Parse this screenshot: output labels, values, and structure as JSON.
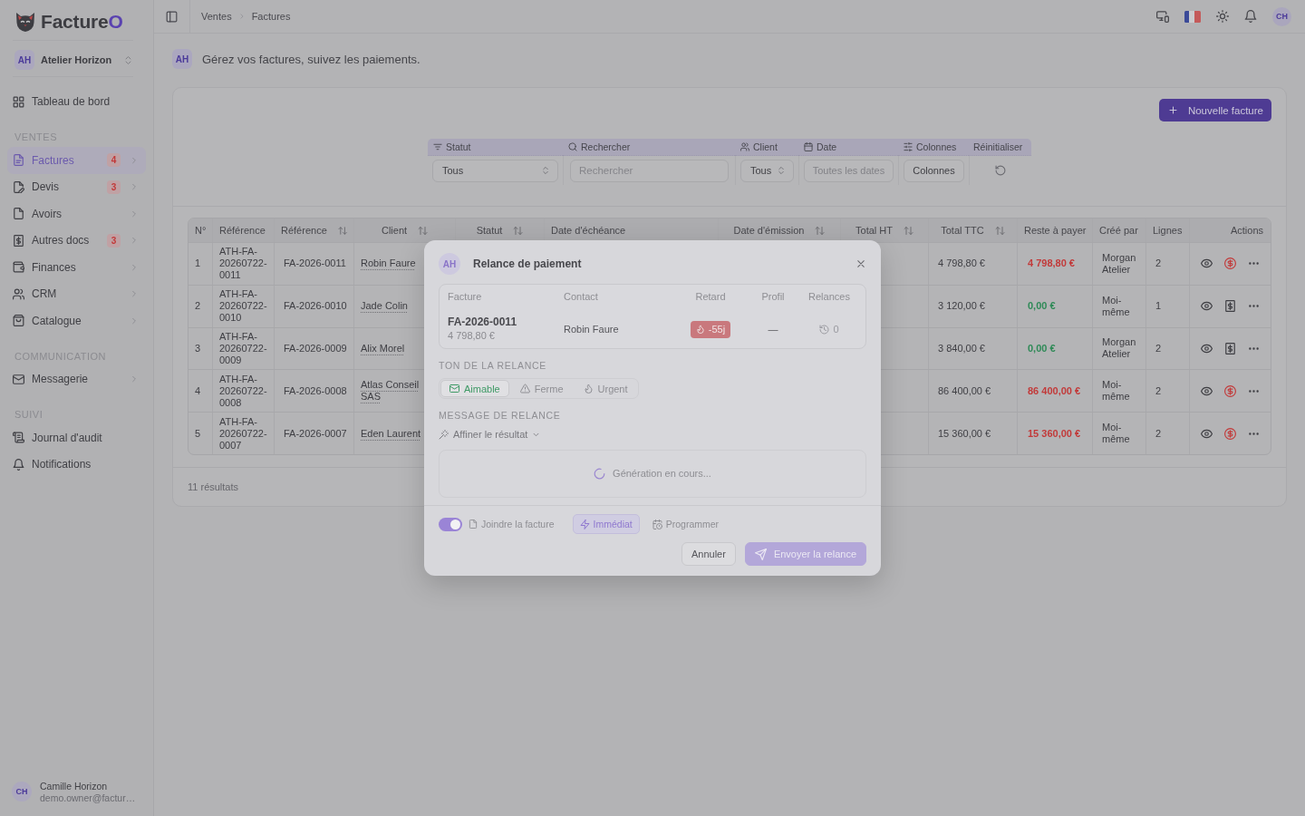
{
  "sidebar": {
    "brand": {
      "name": "Facture",
      "accent": "O"
    },
    "workspace": {
      "initials": "AH",
      "name": "Atelier Horizon"
    },
    "sections": [
      {
        "items": [
          {
            "kind": "dashboard",
            "label": "Tableau de bord",
            "selected": false,
            "expandable": false
          }
        ]
      },
      {
        "title": "VENTES",
        "items": [
          {
            "kind": "invoices",
            "label": "Factures",
            "selected": true,
            "badge": "4",
            "expandable": true
          },
          {
            "kind": "quotes",
            "label": "Devis",
            "selected": false,
            "badge": "3",
            "expandable": true
          },
          {
            "kind": "credit_notes",
            "label": "Avoirs",
            "selected": false,
            "expandable": true
          },
          {
            "kind": "other_docs",
            "label": "Autres docs",
            "selected": false,
            "badge": "3",
            "expandable": true
          },
          {
            "kind": "finances",
            "label": "Finances",
            "selected": false,
            "expandable": true
          },
          {
            "kind": "crm",
            "label": "CRM",
            "selected": false,
            "expandable": true
          },
          {
            "kind": "catalog",
            "label": "Catalogue",
            "selected": false,
            "expandable": true
          }
        ]
      },
      {
        "title": "COMMUNICATION",
        "items": [
          {
            "kind": "messages",
            "label": "Messagerie",
            "selected": false,
            "expandable": true
          }
        ]
      },
      {
        "title": "SUIVI",
        "items": [
          {
            "kind": "audit",
            "label": "Journal d'audit",
            "selected": false,
            "expandable": false
          },
          {
            "kind": "notifications",
            "label": "Notifications",
            "selected": false,
            "expandable": false
          }
        ]
      }
    ],
    "user": {
      "initials": "CH",
      "name": "Camille Horizon",
      "email": "demo.owner@factur…"
    }
  },
  "topbar": {
    "breadcrumb": [
      "Ventes",
      "Factures"
    ],
    "avatar": "CH"
  },
  "page": {
    "avatar": "AH",
    "subtitle": "Gérez vos factures, suivez les paiements."
  },
  "toolbar": {
    "new_button": "Nouvelle facture"
  },
  "filters": [
    {
      "kind": "status",
      "label": "Statut",
      "value": "Tous"
    },
    {
      "kind": "search",
      "label": "Rechercher",
      "placeholder": "Rechercher"
    },
    {
      "kind": "client",
      "label": "Client",
      "value": "Tous"
    },
    {
      "kind": "date",
      "label": "Date",
      "placeholder": "Toutes les dates"
    },
    {
      "kind": "columns",
      "label": "Colonnes",
      "value": "Colonnes"
    },
    {
      "kind": "reset",
      "label": "Réinitialiser"
    }
  ],
  "table": {
    "columns": [
      {
        "label": "N°",
        "sortable": false
      },
      {
        "label": "Référence",
        "sortable": false
      },
      {
        "label": "Référence",
        "sortable": true
      },
      {
        "label": "Client",
        "sortable": true
      },
      {
        "label": "Statut",
        "sortable": true
      },
      {
        "label": "Date d'échéance",
        "sortable": false
      },
      {
        "label": "Date d'émission",
        "sortable": true
      },
      {
        "label": "Total HT",
        "sortable": true
      },
      {
        "label": "Total TTC",
        "sortable": true
      },
      {
        "label": "Reste à payer",
        "sortable": false
      },
      {
        "label": "Créé par",
        "sortable": false
      },
      {
        "label": "Lignes",
        "sortable": false
      },
      {
        "label": "Actions",
        "sortable": false
      }
    ],
    "rows": [
      {
        "number": "1",
        "reference": "ATH-FA-20260722-0011",
        "short_reference": "FA-2026-0011",
        "client": "Robin Faure",
        "total_ttc": "4 798,80 €",
        "balance": "4 798,80 €",
        "paid": false,
        "created_by": "Morgan Atelier",
        "lines": "2",
        "actions": [
          {
            "kind": "view"
          },
          {
            "kind": "payment"
          },
          {
            "kind": "more"
          }
        ]
      },
      {
        "number": "2",
        "reference": "ATH-FA-20260722-0010",
        "short_reference": "FA-2026-0010",
        "client": "Jade Colin",
        "total_ttc": "3 120,00 €",
        "balance": "0,00 €",
        "paid": true,
        "created_by": "Moi-même",
        "lines": "1",
        "actions": [
          {
            "kind": "view"
          },
          {
            "kind": "receipt"
          },
          {
            "kind": "more"
          }
        ]
      },
      {
        "number": "3",
        "reference": "ATH-FA-20260722-0009",
        "short_reference": "FA-2026-0009",
        "client": "Alix Morel",
        "total_ttc": "3 840,00 €",
        "balance": "0,00 €",
        "paid": true,
        "created_by": "Morgan Atelier",
        "lines": "2",
        "actions": [
          {
            "kind": "view"
          },
          {
            "kind": "receipt"
          },
          {
            "kind": "more"
          }
        ]
      },
      {
        "number": "4",
        "reference": "ATH-FA-20260722-0008",
        "short_reference": "FA-2026-0008",
        "client": "Atlas Conseil SAS",
        "total_ttc": "86 400,00 €",
        "balance": "86 400,00 €",
        "paid": false,
        "created_by": "Moi-même",
        "lines": "2",
        "actions": [
          {
            "kind": "view"
          },
          {
            "kind": "payment"
          },
          {
            "kind": "more"
          }
        ]
      },
      {
        "number": "5",
        "reference": "ATH-FA-20260722-0007",
        "short_reference": "FA-2026-0007",
        "client": "Eden Laurent",
        "total_ttc": "15 360,00 €",
        "balance": "15 360,00 €",
        "paid": false,
        "created_by": "Moi-même",
        "lines": "2",
        "actions": [
          {
            "kind": "view"
          },
          {
            "kind": "payment"
          },
          {
            "kind": "more"
          }
        ]
      }
    ]
  },
  "results_count": "11 résultats",
  "modal": {
    "avatar": "AH",
    "title": "Relance de paiement",
    "summary": [
      {
        "kind": "invoice",
        "label": "Facture",
        "value": "FA-2026-0011",
        "amount": "4 798,80 €"
      },
      {
        "kind": "contact",
        "label": "Contact",
        "value": "Robin Faure"
      },
      {
        "kind": "delay",
        "label": "Retard",
        "value": "-55j"
      },
      {
        "kind": "profile",
        "label": "Profil",
        "value": "—"
      },
      {
        "kind": "reminders",
        "label": "Relances",
        "value": "0"
      }
    ],
    "tone": {
      "label": "TON DE LA RELANCE",
      "options": [
        {
          "kind": "friendly",
          "label": "Aimable",
          "selected": true
        },
        {
          "kind": "firm",
          "label": "Ferme",
          "selected": false
        },
        {
          "kind": "urgent",
          "label": "Urgent",
          "selected": false
        }
      ]
    },
    "message": {
      "label": "MESSAGE DE RELANCE",
      "refine": "Affiner le résultat",
      "status": "Génération en cours..."
    },
    "attach": {
      "label": "Joindre la facture",
      "on": true
    },
    "timing": [
      {
        "kind": "now",
        "label": "Immédiat",
        "selected": true
      },
      {
        "kind": "schedule",
        "label": "Programmer",
        "selected": false
      }
    ],
    "buttons": [
      {
        "kind": "cancel",
        "label": "Annuler",
        "disabled": false
      },
      {
        "kind": "send",
        "label": "Envoyer la relance",
        "disabled": true
      }
    ]
  }
}
